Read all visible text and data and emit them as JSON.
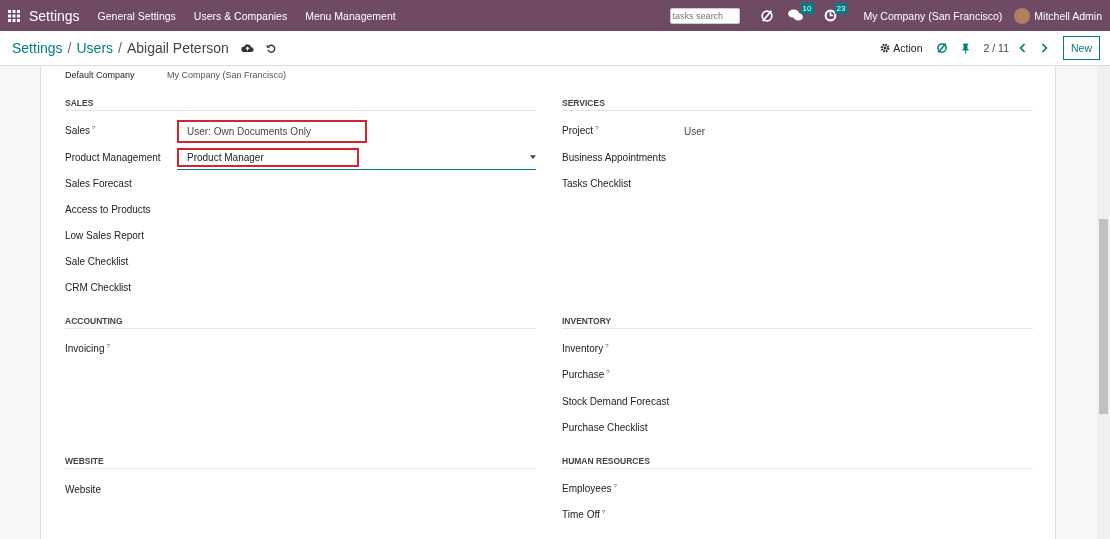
{
  "navbar": {
    "app": "Settings",
    "menus": [
      "General Settings",
      "Users & Companies",
      "Menu Management"
    ],
    "search": {
      "placeholder": "tasks search"
    },
    "messages_badge": "10",
    "activities_badge": "23",
    "company": "My Company (San Francisco)",
    "user": "Mitchell Admin"
  },
  "control_panel": {
    "breadcrumbs": [
      {
        "label": "Settings",
        "link": true
      },
      {
        "label": "Users",
        "link": true
      },
      {
        "label": "Abigail Peterson",
        "link": false
      }
    ],
    "separators": [
      "/",
      "/"
    ],
    "action": "Action",
    "pager": "2 / 11",
    "new_button": "New"
  },
  "top_row": {
    "label": "Default Company",
    "value": "My Company (San Francisco)"
  },
  "sections": [
    {
      "title": "SALES",
      "rows": [
        {
          "label": "Sales",
          "help": "?",
          "kind": "text",
          "value": "User: Own Documents Only",
          "highlighted": true
        },
        {
          "label": "Product Management",
          "kind": "select",
          "value": "Product Manager",
          "highlighted": true
        },
        {
          "label": "Sales Forecast",
          "kind": "none"
        },
        {
          "label": "Access to Products",
          "kind": "none"
        },
        {
          "label": "Low Sales Report",
          "kind": "none"
        },
        {
          "label": "Sale Checklist",
          "kind": "none"
        },
        {
          "label": "CRM Checklist",
          "kind": "none"
        }
      ]
    },
    {
      "title": "SERVICES",
      "rows": [
        {
          "label": "Project",
          "help": "?",
          "kind": "text",
          "value": "User",
          "highlighted": false
        },
        {
          "label": "Business Appointments",
          "kind": "none"
        },
        {
          "label": "Tasks Checklist",
          "kind": "none"
        }
      ]
    },
    {
      "title": "ACCOUNTING",
      "rows": [
        {
          "label": "Invoicing",
          "help": "?",
          "kind": "none"
        }
      ]
    },
    {
      "title": "INVENTORY",
      "rows": [
        {
          "label": "Inventory",
          "help": "?",
          "kind": "none"
        },
        {
          "label": "Purchase",
          "help": "?",
          "kind": "none"
        },
        {
          "label": "Stock Demand Forecast",
          "kind": "none"
        },
        {
          "label": "Purchase Checklist",
          "kind": "none"
        }
      ]
    },
    {
      "title": "WEBSITE",
      "rows": [
        {
          "label": "Website",
          "kind": "none"
        }
      ]
    },
    {
      "title": "HUMAN RESOURCES",
      "rows": [
        {
          "label": "Employees",
          "help": "?",
          "kind": "none"
        },
        {
          "label": "Time Off",
          "help": "?",
          "kind": "none"
        }
      ]
    }
  ]
}
